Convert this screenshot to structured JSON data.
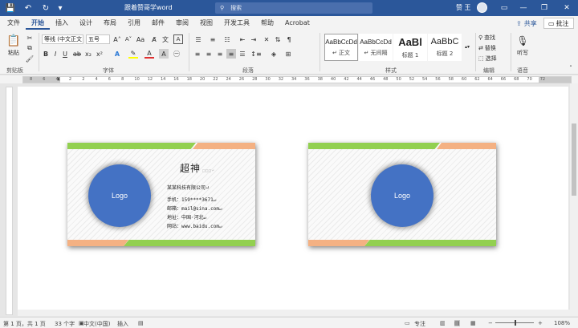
{
  "window": {
    "title": "跟着赞哥学word",
    "search_placeholder": "搜索",
    "user_name": "赞 王",
    "controls": [
      "—",
      "❐",
      "✕"
    ]
  },
  "menu": {
    "tabs": [
      "文件",
      "开始",
      "插入",
      "设计",
      "布局",
      "引用",
      "邮件",
      "审阅",
      "视图",
      "开发工具",
      "帮助",
      "Acrobat"
    ],
    "active_tab": "开始",
    "share_label": "共享",
    "comment_label": "批注"
  },
  "ribbon": {
    "clipboard": {
      "paste_label": "粘贴",
      "group_label": "剪贴板"
    },
    "font": {
      "font_name": "等线 (中文正文",
      "font_size": "五号",
      "group_label": "字体"
    },
    "paragraph": {
      "group_label": "段落"
    },
    "styles": {
      "group_label": "样式",
      "items": [
        {
          "sample": "AaBbCcDd",
          "name": "↵ 正文"
        },
        {
          "sample": "AaBbCcDd",
          "name": "↵ 无间隔"
        },
        {
          "sample": "AaBl",
          "name": "标题 1"
        },
        {
          "sample": "AaBbC",
          "name": "标题 2"
        }
      ]
    },
    "editing": {
      "group_label": "编辑",
      "find_label": "查找",
      "replace_label": "替换",
      "select_label": "选择"
    },
    "voice": {
      "group_label": "语音",
      "dictate_label": "听写"
    }
  },
  "ruler": {
    "numbers": [
      "8",
      "6",
      "4",
      "2",
      "2",
      "4",
      "6",
      "8",
      "10",
      "12",
      "14",
      "16",
      "18",
      "20",
      "22",
      "24",
      "26",
      "28",
      "30",
      "32",
      "34",
      "36",
      "38",
      "40",
      "42",
      "44",
      "46",
      "48",
      "50",
      "52",
      "54",
      "56",
      "58",
      "60",
      "62",
      "64",
      "66",
      "68",
      "70",
      "72"
    ]
  },
  "card_front": {
    "logo_text": "Logo",
    "name": "超神",
    "name_suffix": "□□□↵",
    "company": "某某科技有限公司↵",
    "lines": [
      "手机：159****3671↵",
      "邮箱：mail@sina.com↵",
      "地址：中国·河北↵",
      "网站：www.baidu.com↵"
    ]
  },
  "card_back": {
    "logo_text": "Logo"
  },
  "colors": {
    "word_blue": "#2b579a",
    "green_bar": "#92d050",
    "orange_bar": "#f4b183",
    "logo_blue": "#4472c4"
  },
  "status": {
    "page": "第 1 页，共 1 页",
    "words": "33 个字",
    "language": "中文(中国)",
    "insert": "插入",
    "focus": "专注",
    "zoom": "108%"
  }
}
